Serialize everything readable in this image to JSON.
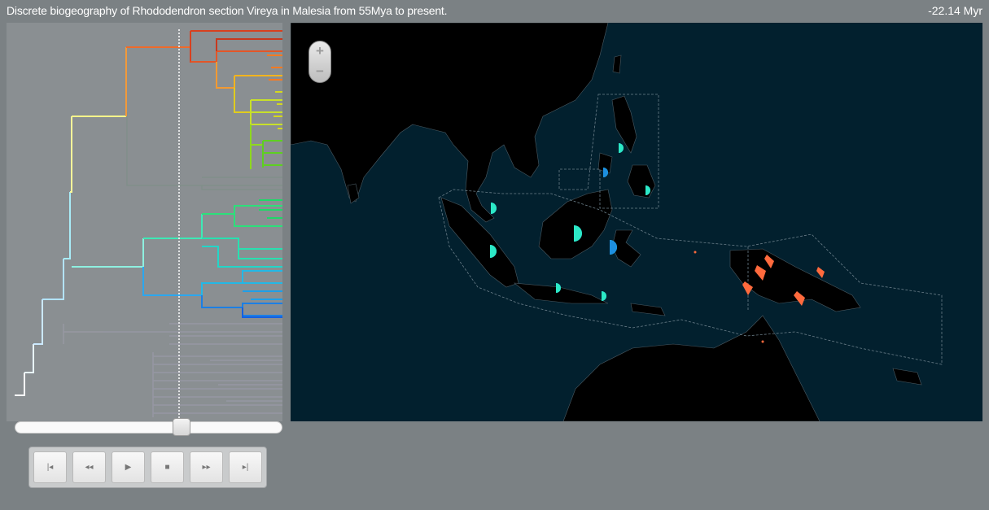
{
  "header": {
    "title": "Discrete biogeography of Rhododendron section Vireya in Malesia from 55Mya to present.",
    "time_readout": "-22.14 Myr"
  },
  "timeline": {
    "slider_fraction": 0.6,
    "buttons": [
      {
        "name": "skip-to-start-button",
        "icon": "skip-start-icon",
        "glyph": "|◂"
      },
      {
        "name": "rewind-button",
        "icon": "rewind-icon",
        "glyph": "◂◂"
      },
      {
        "name": "play-button",
        "icon": "play-icon",
        "glyph": "▶"
      },
      {
        "name": "stop-button",
        "icon": "stop-icon",
        "glyph": "■"
      },
      {
        "name": "fast-forward-button",
        "icon": "fast-forward-icon",
        "glyph": "▸▸"
      },
      {
        "name": "skip-to-end-button",
        "icon": "skip-end-icon",
        "glyph": "▸|"
      }
    ]
  },
  "map": {
    "zoom_in_label": "+",
    "zoom_out_label": "−",
    "colors": {
      "ocean": "#02202e",
      "land": "#000000",
      "cyan": "#2ce8c6",
      "blue": "#1d8fe0",
      "orange": "#ff6a3d"
    }
  }
}
